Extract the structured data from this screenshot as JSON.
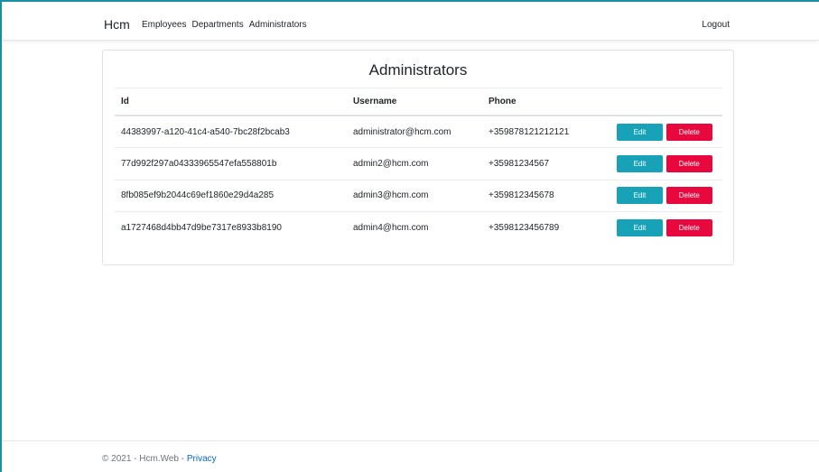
{
  "nav": {
    "brand": "Hcm",
    "links": [
      "Employees",
      "Departments",
      "Administrators"
    ],
    "logout": "Logout"
  },
  "page": {
    "title": "Administrators"
  },
  "table": {
    "headers": {
      "id": "Id",
      "username": "Username",
      "phone": "Phone"
    },
    "rows": [
      {
        "id": "44383997-a120-41c4-a540-7bc28f2bcab3",
        "username": "administrator@hcm.com",
        "phone": "+359878121212121"
      },
      {
        "id": "77d992f297a04333965547efa558801b",
        "username": "admin2@hcm.com",
        "phone": "+35981234567"
      },
      {
        "id": "8fb085ef9b2044c69ef1860e29d4a285",
        "username": "admin3@hcm.com",
        "phone": "+359812345678"
      },
      {
        "id": "a1727468d4bb47d9be7317e8933b8190",
        "username": "admin4@hcm.com",
        "phone": "+3598123456789"
      }
    ],
    "edit_label": "Edit",
    "delete_label": "Delete"
  },
  "footer": {
    "text": "© 2021 - Hcm.Web - ",
    "privacy": "Privacy"
  },
  "colors": {
    "edit": "#17a2b8",
    "delete": "#e8083e",
    "link": "#0366d6",
    "frame": "#1a8fa8"
  }
}
